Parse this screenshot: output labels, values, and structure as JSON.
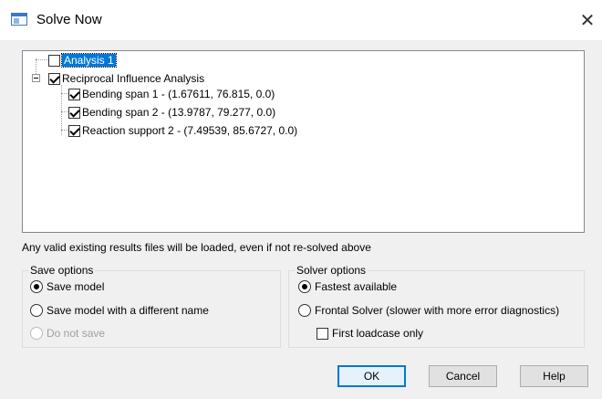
{
  "window": {
    "title": "Solve Now",
    "close_glyph": "✕"
  },
  "tree": {
    "items": [
      {
        "label": "Analysis 1",
        "checked": false,
        "selected": true
      },
      {
        "label": "Reciprocal Influence Analysis",
        "checked": true,
        "expanded": true
      },
      {
        "label": "Bending span 1 - (1.67611, 76.815, 0.0)",
        "checked": true
      },
      {
        "label": "Bending span 2 - (13.9787, 79.277, 0.0)",
        "checked": true
      },
      {
        "label": "Reaction support 2 - (7.49539, 85.6727, 0.0)",
        "checked": true
      }
    ]
  },
  "info_text": "Any valid existing results files will be loaded, even if not re-solved above",
  "save_options": {
    "title": "Save options",
    "options": [
      {
        "label": "Save model",
        "selected": true,
        "enabled": true
      },
      {
        "label": "Save model with a different name",
        "selected": false,
        "enabled": true
      },
      {
        "label": "Do not save",
        "selected": false,
        "enabled": false
      }
    ]
  },
  "solver_options": {
    "title": "Solver options",
    "options": [
      {
        "label": "Fastest available",
        "selected": true
      },
      {
        "label": "Frontal Solver (slower with more error diagnostics)",
        "selected": false
      }
    ],
    "first_loadcase_only": {
      "label": "First loadcase only",
      "checked": false
    }
  },
  "buttons": {
    "ok": "OK",
    "cancel": "Cancel",
    "help": "Help"
  },
  "colors": {
    "selection": "#0078d7",
    "dialog_bg": "#f0f0f0"
  }
}
